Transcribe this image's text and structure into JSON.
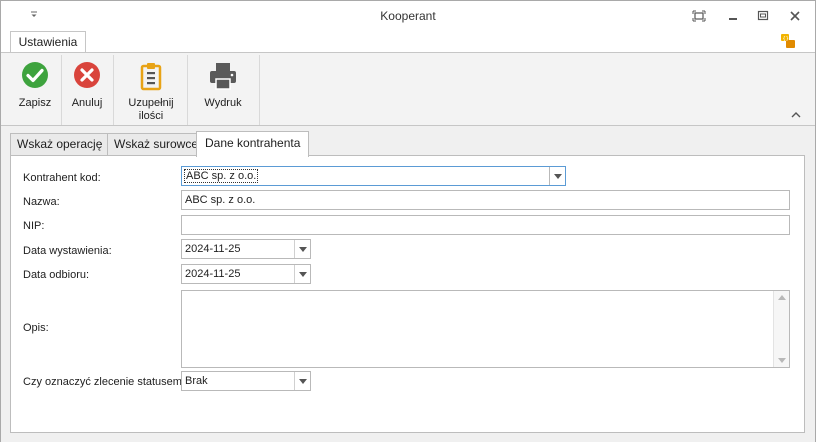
{
  "window": {
    "title": "Kooperant",
    "qat_icon": "customize-quick-access-icon",
    "buttons": [
      "restore-ribbon-icon",
      "minimize-icon",
      "maximize-icon",
      "close-icon"
    ]
  },
  "ribbon": {
    "tab_label": "Ustawienia",
    "skin_icon": "skin-switch-icon",
    "buttons": {
      "save": {
        "label": "Zapisz",
        "icon": "check-circle-icon",
        "color": "#3ea33e"
      },
      "cancel": {
        "label": "Anuluj",
        "icon": "x-circle-icon",
        "color": "#d9443c"
      },
      "fill": {
        "label_line1": "Uzupełnij",
        "label_line2": "ilości",
        "icon": "clipboard-icon",
        "color": "#e8a316"
      },
      "print": {
        "label": "Wydruk",
        "icon": "printer-icon",
        "color": "#5a5a5a"
      }
    }
  },
  "tabs": {
    "operations": "Wskaż operację",
    "materials": "Wskaż surowce",
    "contractor": "Dane kontrahenta",
    "active": "Dane kontrahenta"
  },
  "form": {
    "contractor_code": {
      "label": "Kontrahent kod:",
      "value": "ABC sp. z o.o."
    },
    "name": {
      "label": "Nazwa:",
      "value": "ABC sp. z o.o."
    },
    "nip": {
      "label": "NIP:",
      "value": ""
    },
    "issue_date": {
      "label": "Data wystawienia:",
      "value": "2024-11-25"
    },
    "pickup_date": {
      "label": "Data odbioru:",
      "value": "2024-11-25"
    },
    "description": {
      "label": "Opis:",
      "value": ""
    },
    "status": {
      "label": "Czy oznaczyć zlecenie statusem",
      "value": "Brak"
    }
  },
  "colors": {
    "accent": "#5b9bd5",
    "border": "#b9b9b9"
  }
}
